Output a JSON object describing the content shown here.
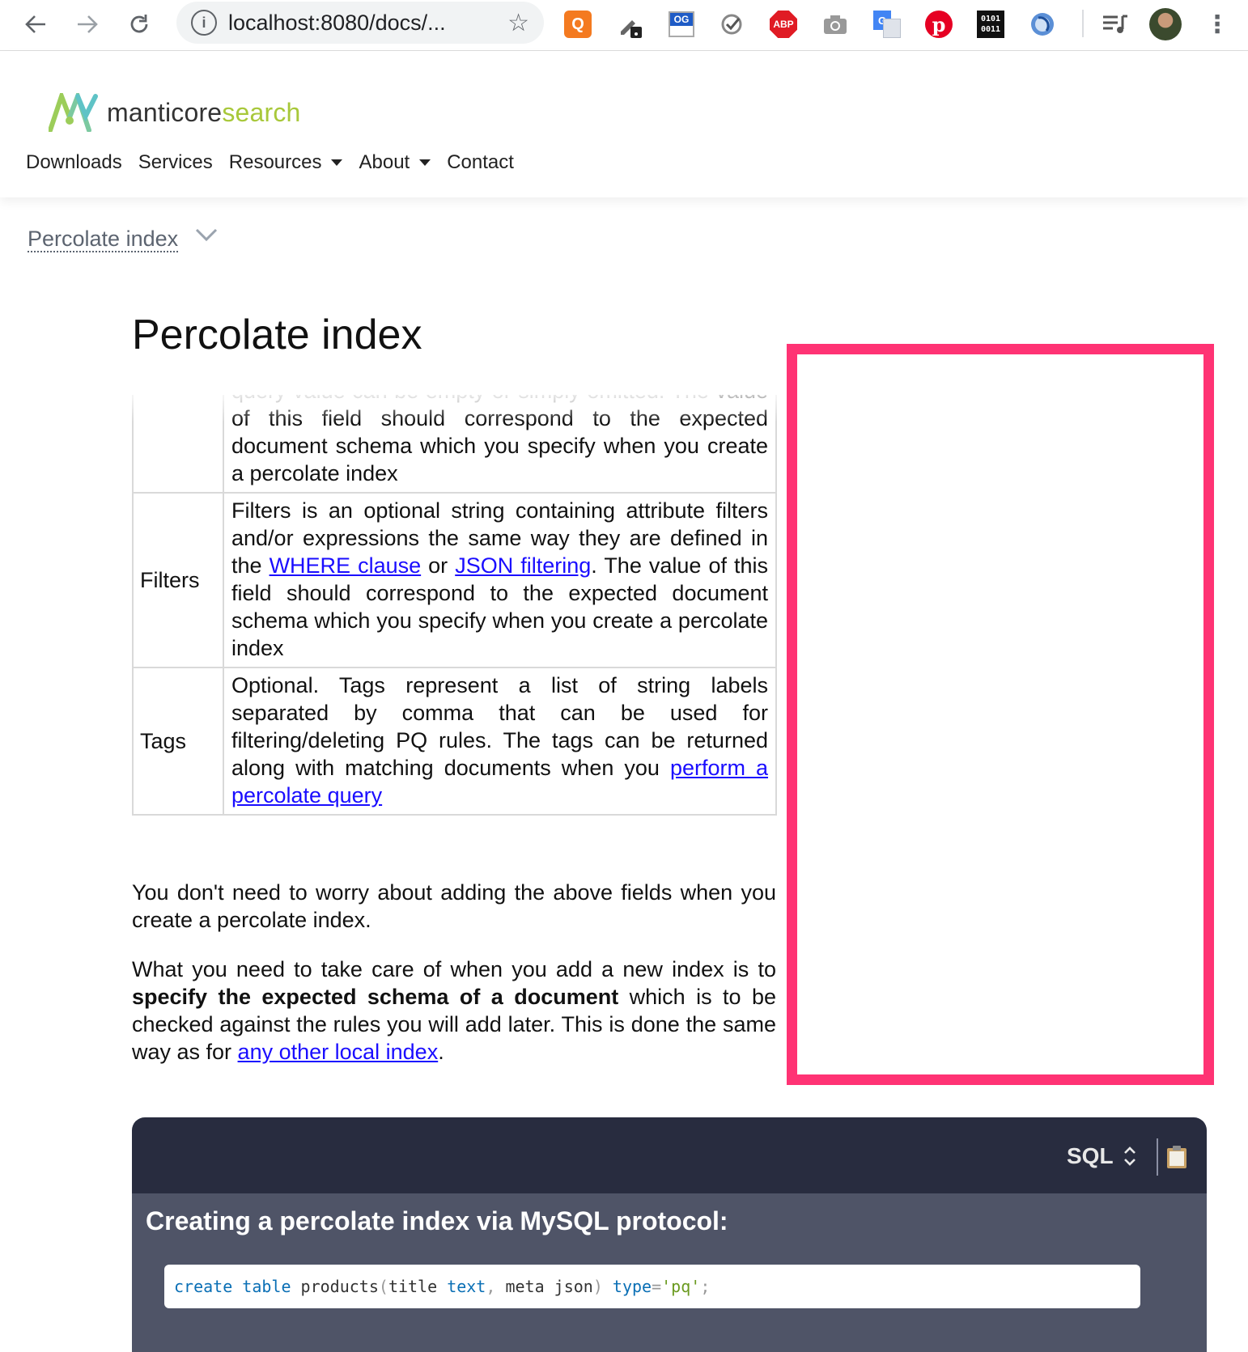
{
  "browser": {
    "url": "localhost:8080/docs/...",
    "extensions": [
      "search-extension-icon",
      "eyedropper-icon",
      "og-icon",
      "checkmark-icon",
      "ABP",
      "camera-icon",
      "google-translate-icon",
      "pinterest-icon",
      "0101 0011",
      "sync-icon",
      "media-icon",
      "profile-avatar"
    ],
    "abp_label": "ABP",
    "og_label": "OG",
    "binary_label_1": "0101",
    "binary_label_2": "0011"
  },
  "site": {
    "logo_a": "manticore",
    "logo_b": "search",
    "nav": {
      "downloads": "Downloads",
      "services": "Services",
      "resources": "Resources",
      "about": "About",
      "contact": "Contact"
    }
  },
  "breadcrumb": "Percolate index",
  "page_title": "Percolate index",
  "table": {
    "row0": {
      "cut_line": "query value can be empty or simply omitted. The",
      "desc": "value of this field should correspond to the expected document schema which you specify when you create a percolate index"
    },
    "row1": {
      "name": "Filters",
      "desc_a": "Filters is an optional string containing attribute filters and/or expressions the same way they are defined in the ",
      "link1": "WHERE clause",
      "desc_b": " or ",
      "link2": "JSON filtering",
      "desc_c": ". The value of this field should correspond to the expected document schema which you specify when you create a percolate index"
    },
    "row2": {
      "name": "Tags",
      "desc_a": "Optional. Tags represent a list of string labels separated by comma that can be used for filtering/deleting PQ rules. The tags can be returned along with matching documents when you ",
      "link": "perform a percolate query"
    }
  },
  "para1": "You don't need to worry about adding the above fields when you create a percolate index.",
  "para2": {
    "a": "What you need to take care of when you add a new index is to ",
    "bold": "specify the expected schema of a document",
    "b": " which is to be checked against the rules you will add later. This is done the same way as for ",
    "link": "any other local index",
    "c": "."
  },
  "code": {
    "lang": "SQL",
    "heading": "Creating a percolate index via MySQL protocol:",
    "tokens": {
      "t1": "create",
      "t2": " ",
      "t3": "table",
      "t4": " products",
      "t5": "(",
      "t6": "title ",
      "t7": "text",
      "t8": ",",
      "t9": " meta json",
      "t10": ")",
      "t11": " ",
      "t12": "type",
      "t13": "=",
      "t14": "'pq'",
      "t15": ";"
    }
  },
  "colors": {
    "highlight_box": "#ff3374",
    "code_bg": "#282c3f",
    "code_panel": "#4f5467",
    "link": "#1a0dff",
    "logo_green": "#a8c83a"
  }
}
